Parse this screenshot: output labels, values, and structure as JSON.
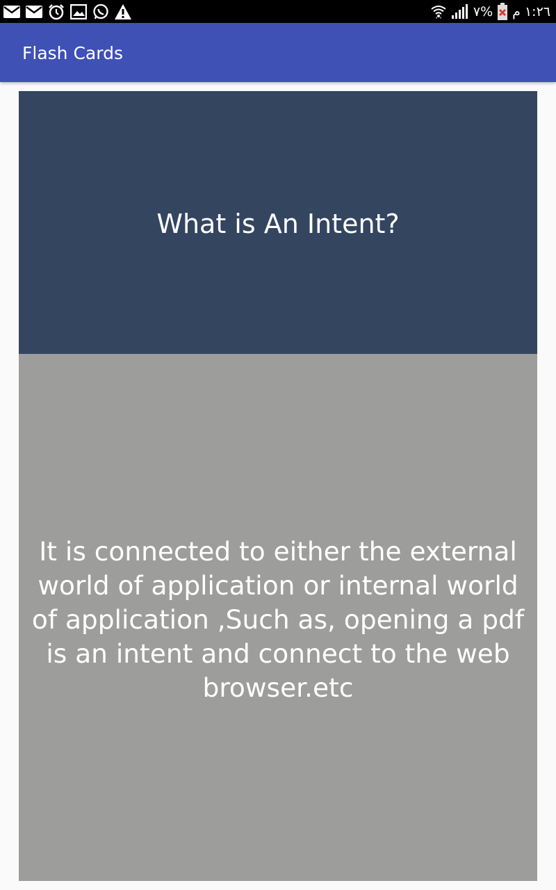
{
  "status_bar": {
    "left_icons": [
      "mail-icon",
      "mail-icon",
      "alarm-clock-icon",
      "image-icon",
      "whatsapp-icon",
      "warning-icon"
    ],
    "right_icons": [
      "wifi-icon",
      "signal-icon",
      "battery-icon"
    ],
    "battery_text": "٧%",
    "time": "١:٢٦ م"
  },
  "app_bar": {
    "title": "Flash Cards",
    "color": "#3f51b5"
  },
  "card": {
    "question": "What is An Intent?",
    "answer": "It is connected to either the external world of application or internal world of application ,Such as, opening a pdf is an intent and connect to the web browser.etc",
    "front_color": "#344560",
    "back_color": "#9d9e9b"
  }
}
